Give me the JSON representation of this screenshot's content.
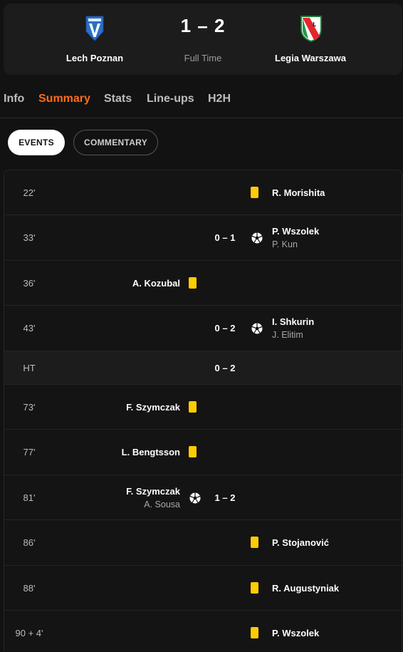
{
  "match": {
    "home_team": "Lech Poznan",
    "away_team": "Legia Warszawa",
    "score": "1 – 2",
    "status": "Full Time"
  },
  "tabs": [
    {
      "label": "Info"
    },
    {
      "label": "Summary",
      "active": true
    },
    {
      "label": "Stats"
    },
    {
      "label": "Line-ups"
    },
    {
      "label": "H2H"
    }
  ],
  "toggles": {
    "events_label": "EVENTS",
    "commentary_label": "COMMENTARY"
  },
  "events": [
    {
      "minute": "22'",
      "side": "away",
      "type": "yellow-card",
      "player": "R. Morishita"
    },
    {
      "minute": "33'",
      "side": "away",
      "type": "goal",
      "score": "0 – 1",
      "player": "P. Wszolek",
      "assist": "P. Kun"
    },
    {
      "minute": "36'",
      "side": "home",
      "type": "yellow-card",
      "player": "A. Kozubal"
    },
    {
      "minute": "43'",
      "side": "away",
      "type": "goal",
      "score": "0 – 2",
      "player": "I. Shkurin",
      "assist": "J. Elitim"
    },
    {
      "minute": "HT",
      "type": "half-time",
      "score": "0 – 2"
    },
    {
      "minute": "73'",
      "side": "home",
      "type": "yellow-card",
      "player": "F. Szymczak"
    },
    {
      "minute": "77'",
      "side": "home",
      "type": "yellow-card",
      "player": "L. Bengtsson"
    },
    {
      "minute": "81'",
      "side": "home",
      "type": "goal",
      "score": "1 – 2",
      "player": "F. Szymczak",
      "assist": "A. Sousa"
    },
    {
      "minute": "86'",
      "side": "away",
      "type": "yellow-card",
      "player": "P. Stojanović"
    },
    {
      "minute": "88'",
      "side": "away",
      "type": "yellow-card",
      "player": "R. Augustyniak"
    },
    {
      "minute": "90 + 4'",
      "side": "away",
      "type": "yellow-card",
      "player": "P. Wszolek"
    }
  ],
  "colors": {
    "accent": "#ff6b1a",
    "yellow_card": "#ffcc00",
    "background": "#121212",
    "panel": "#1c1c1c"
  }
}
